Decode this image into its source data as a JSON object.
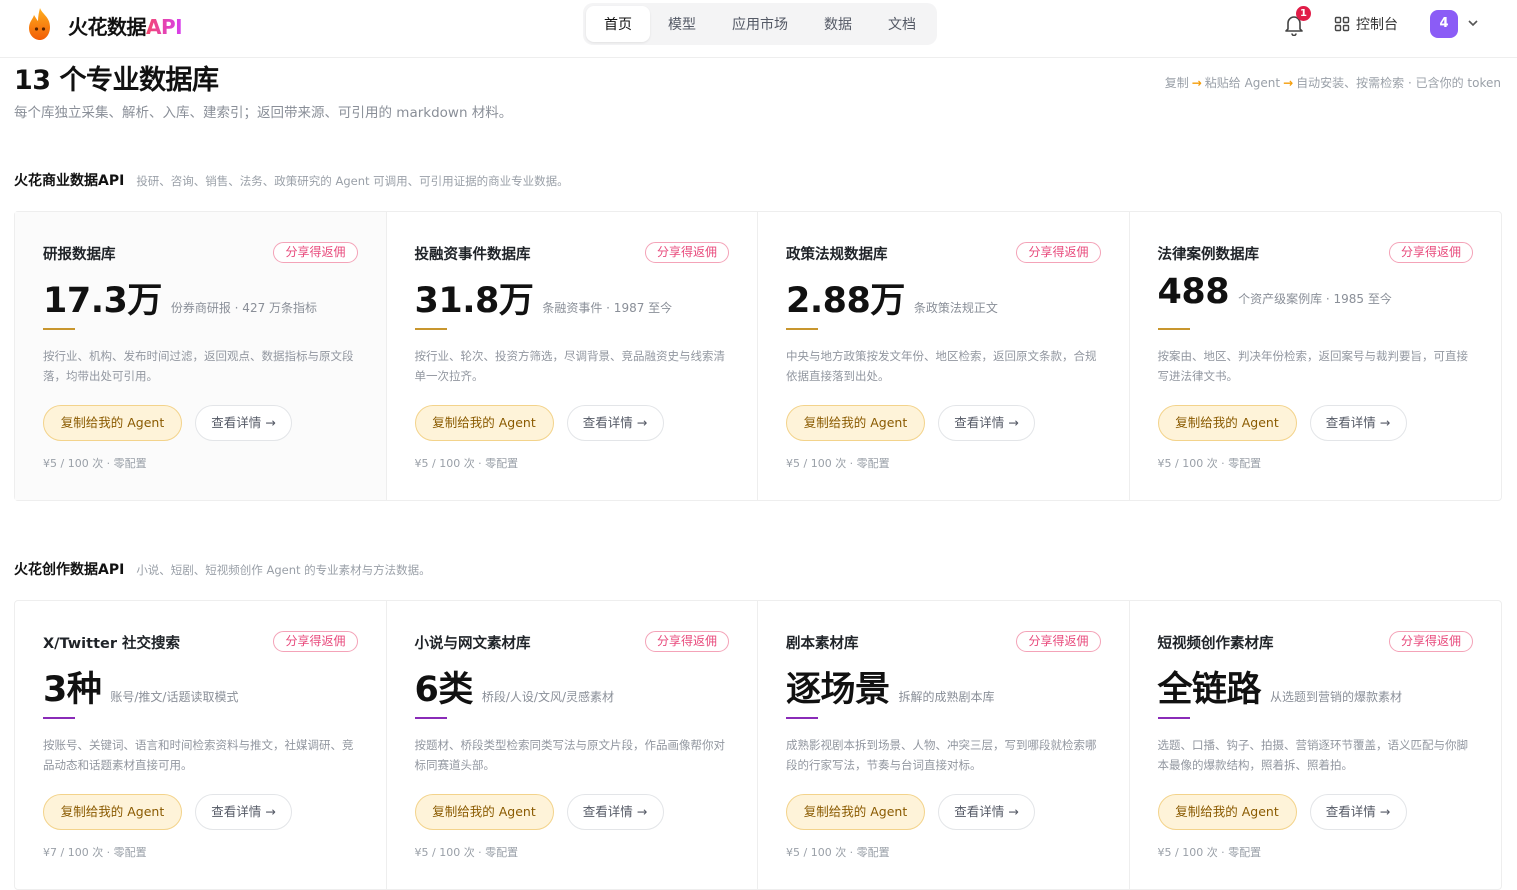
{
  "brand": {
    "name": "火花数据",
    "api": "API"
  },
  "nav": {
    "items": [
      {
        "label": "首页",
        "active": true
      },
      {
        "label": "模型",
        "active": false
      },
      {
        "label": "应用市场",
        "active": false
      },
      {
        "label": "数据",
        "active": false
      },
      {
        "label": "文档",
        "active": false
      }
    ],
    "notification_count": "1",
    "console_label": "控制台",
    "avatar_label": "4"
  },
  "header": {
    "title": "13 个专业数据库",
    "subtitle": "每个库独立采集、解析、入库、建索引；返回带来源、可引用的 markdown 材料。",
    "howto": [
      "复制",
      "粘贴给 Agent",
      "自动安装、按需检索 · 已含你的 token"
    ]
  },
  "sections": [
    {
      "title": "火花商业数据API",
      "desc": "投研、咨询、销售、法务、政策研究的 Agent 可调用、可引用证据的商业专业数据。",
      "accent": "#c8962e",
      "cards": [
        {
          "name": "研报数据库",
          "badge": "分享得返佣",
          "value": "17.3万",
          "value_label": "份券商研报 · 427 万条指标",
          "desc": "按行业、机构、发布时间过滤，返回观点、数据指标与原文段落，均带出处可引用。",
          "copy_label": "复制给我的 Agent",
          "detail_label": "查看详情 →",
          "price": "¥5 / 100 次 · 零配置"
        },
        {
          "name": "投融资事件数据库",
          "badge": "分享得返佣",
          "value": "31.8万",
          "value_label": "条融资事件 · 1987 至今",
          "desc": "按行业、轮次、投资方筛选，尽调背景、竞品融资史与线索清单一次拉齐。",
          "copy_label": "复制给我的 Agent",
          "detail_label": "查看详情 →",
          "price": "¥5 / 100 次 · 零配置"
        },
        {
          "name": "政策法规数据库",
          "badge": "分享得返佣",
          "value": "2.88万",
          "value_label": "条政策法规正文",
          "desc": "中央与地方政策按发文年份、地区检索，返回原文条款，合规依据直接落到出处。",
          "copy_label": "复制给我的 Agent",
          "detail_label": "查看详情 →",
          "price": "¥5 / 100 次 · 零配置"
        },
        {
          "name": "法律案例数据库",
          "badge": "分享得返佣",
          "value": "488",
          "value_label": "个资产级案例库 · 1985 至今",
          "desc": "按案由、地区、判决年份检索，返回案号与裁判要旨，可直接写进法律文书。",
          "copy_label": "复制给我的 Agent",
          "detail_label": "查看详情 →",
          "price": "¥5 / 100 次 · 零配置"
        }
      ]
    },
    {
      "title": "火花创作数据API",
      "desc": "小说、短剧、短视频创作 Agent 的专业素材与方法数据。",
      "accent": "#8a2bb8",
      "cards": [
        {
          "name": "X/Twitter 社交搜索",
          "badge": "分享得返佣",
          "value": "3种",
          "value_label": "账号/推文/话题读取模式",
          "desc": "按账号、关键词、语言和时间检索资料与推文，社媒调研、竞品动态和话题素材直接可用。",
          "copy_label": "复制给我的 Agent",
          "detail_label": "查看详情 →",
          "price": "¥7 / 100 次 · 零配置"
        },
        {
          "name": "小说与网文素材库",
          "badge": "分享得返佣",
          "value": "6类",
          "value_label": "桥段/人设/文风/灵感素材",
          "desc": "按题材、桥段类型检索同类写法与原文片段，作品画像帮你对标同赛道头部。",
          "copy_label": "复制给我的 Agent",
          "detail_label": "查看详情 →",
          "price": "¥5 / 100 次 · 零配置"
        },
        {
          "name": "剧本素材库",
          "badge": "分享得返佣",
          "value": "逐场景",
          "value_label": "拆解的成熟剧本库",
          "desc": "成熟影视剧本拆到场景、人物、冲突三层，写到哪段就检索哪段的行家写法，节奏与台词直接对标。",
          "copy_label": "复制给我的 Agent",
          "detail_label": "查看详情 →",
          "price": "¥5 / 100 次 · 零配置"
        },
        {
          "name": "短视频创作素材库",
          "badge": "分享得返佣",
          "value": "全链路",
          "value_label": "从选题到营销的爆款素材",
          "desc": "选题、口播、钩子、拍摄、营销逐环节覆盖，语义匹配与你脚本最像的爆款结构，照着拆、照着拍。",
          "copy_label": "复制给我的 Agent",
          "detail_label": "查看详情 →",
          "price": "¥5 / 100 次 · 零配置"
        }
      ]
    }
  ]
}
